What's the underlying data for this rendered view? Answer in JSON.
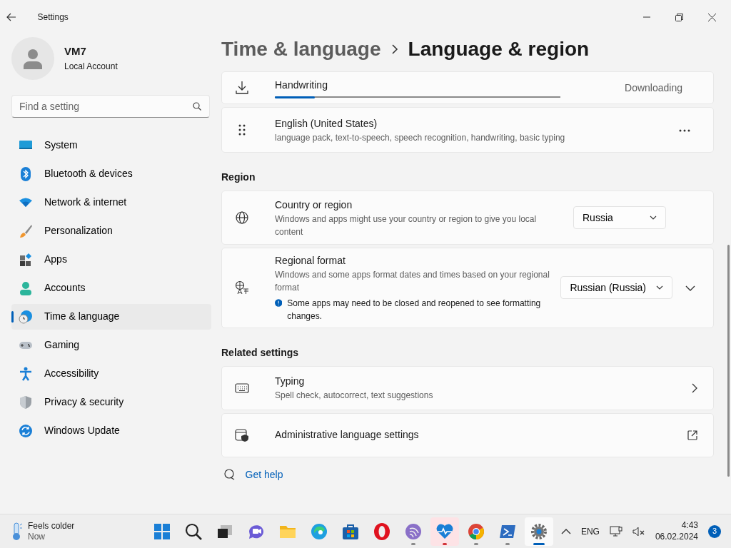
{
  "window": {
    "title": "Settings"
  },
  "user": {
    "name": "VM7",
    "account": "Local Account"
  },
  "search": {
    "placeholder": "Find a setting"
  },
  "nav": [
    {
      "label": "System",
      "kind": "system",
      "selected": false
    },
    {
      "label": "Bluetooth & devices",
      "kind": "bluetooth",
      "selected": false
    },
    {
      "label": "Network & internet",
      "kind": "wifi",
      "selected": false
    },
    {
      "label": "Personalization",
      "kind": "brush",
      "selected": false
    },
    {
      "label": "Apps",
      "kind": "apps",
      "selected": false
    },
    {
      "label": "Accounts",
      "kind": "person",
      "selected": false
    },
    {
      "label": "Time & language",
      "kind": "globe",
      "selected": true
    },
    {
      "label": "Gaming",
      "kind": "gamepad",
      "selected": false
    },
    {
      "label": "Accessibility",
      "kind": "access",
      "selected": false
    },
    {
      "label": "Privacy & security",
      "kind": "shield",
      "selected": false
    },
    {
      "label": "Windows Update",
      "kind": "update",
      "selected": false
    }
  ],
  "breadcrumb": {
    "parent": "Time & language",
    "current": "Language & region"
  },
  "languages": [
    {
      "kind": "download",
      "name": "Handwriting",
      "level": 0.14,
      "status": "Downloading"
    },
    {
      "kind": "language",
      "name": "English (United States)",
      "detail": "language pack, text-to-speech, speech recognition, handwriting, basic typing"
    }
  ],
  "region": {
    "heading": "Region",
    "rows": [
      {
        "kind": "globe",
        "title": "Country or region",
        "description": "Windows and apps might use your country or region to give you local content",
        "value": "Russia"
      },
      {
        "kind": "format",
        "title": "Regional format",
        "description": "Windows and some apps format dates and times based on your regional format",
        "note": "Some apps may need to be closed and reopened to see formatting changes.",
        "value": "Russian (Russia)",
        "expanded": false
      }
    ]
  },
  "related": {
    "heading": "Related settings",
    "items": [
      {
        "kind": "keyboard",
        "title": "Typing",
        "description": "Spell check, autocorrect, text suggestions"
      },
      {
        "kind": "admin",
        "title": "Administrative language settings"
      }
    ]
  },
  "help": {
    "label": "Get help"
  },
  "taskbar": {
    "weather": {
      "title": "Feels colder",
      "subtitle": "Now"
    },
    "apps": [
      {
        "kind": "start",
        "running": false,
        "selected": false,
        "flashing": false
      },
      {
        "kind": "search",
        "running": false,
        "selected": false,
        "flashing": false
      },
      {
        "kind": "taskview",
        "running": false,
        "selected": false,
        "flashing": false
      },
      {
        "kind": "chat",
        "running": false,
        "selected": false,
        "flashing": false
      },
      {
        "kind": "explorer",
        "running": false,
        "selected": false,
        "flashing": false
      },
      {
        "kind": "edge",
        "running": false,
        "selected": false,
        "flashing": false
      },
      {
        "kind": "store",
        "running": false,
        "selected": false,
        "flashing": false
      },
      {
        "kind": "opera",
        "running": false,
        "selected": false,
        "flashing": false
      },
      {
        "kind": "torrent",
        "running": true,
        "selected": false,
        "flashing": false
      },
      {
        "kind": "health",
        "running": true,
        "selected": false,
        "flashing": true
      },
      {
        "kind": "chrome",
        "running": true,
        "selected": false,
        "flashing": false
      },
      {
        "kind": "terminal",
        "running": true,
        "selected": false,
        "flashing": false
      },
      {
        "kind": "settings",
        "running": true,
        "selected": true,
        "flashing": false
      }
    ],
    "language": "ENG",
    "time": "4:43",
    "date": "06.02.2024",
    "notifications": "3"
  }
}
